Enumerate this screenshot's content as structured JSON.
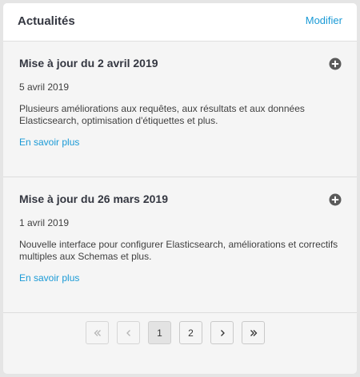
{
  "header": {
    "title": "Actualités",
    "edit_label": "Modifier"
  },
  "news": [
    {
      "title": "Mise à jour du 2 avril 2019",
      "date": "5 avril 2019",
      "description": "Plusieurs améliorations aux requêtes, aux résultats et aux données Elasticsearch, optimisation d'étiquettes et plus.",
      "link": "En savoir plus",
      "icon": "plus-circle-icon"
    },
    {
      "title": "Mise à jour du 26 mars 2019",
      "date": "1 avril 2019",
      "description": "Nouvelle interface pour configurer Elasticsearch, améliorations et correctifs multiples aux Schemas et plus.",
      "link": "En savoir plus",
      "icon": "plus-circle-icon"
    }
  ],
  "pagination": {
    "pages": [
      "1",
      "2"
    ],
    "current": "1",
    "icons": {
      "first": "double-chevron-left-icon",
      "prev": "chevron-left-icon",
      "next": "chevron-right-icon",
      "last": "double-chevron-right-icon"
    }
  },
  "colors": {
    "accent": "#1a9ad6",
    "background": "#f5f5f5",
    "icon": "#5a5a5a"
  }
}
